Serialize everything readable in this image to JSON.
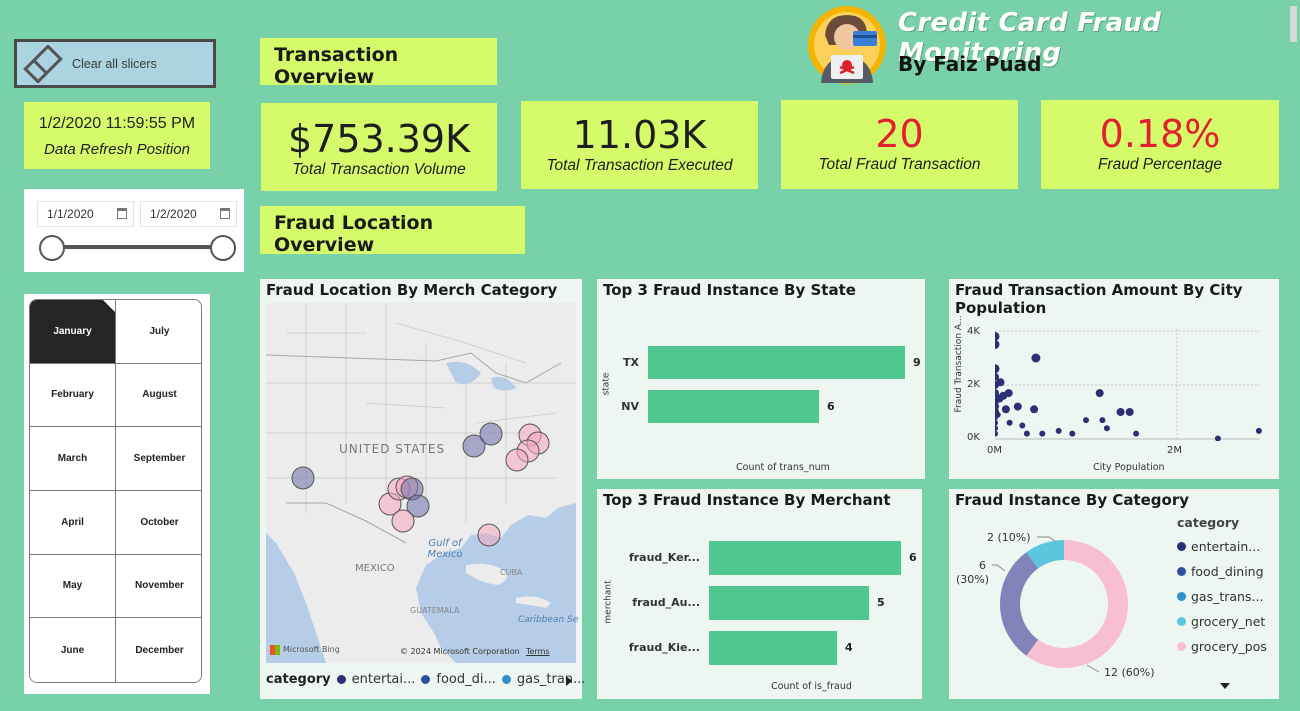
{
  "header": {
    "title": "Credit Card Fraud Monitoring",
    "subtitle": "By Faiz Puad"
  },
  "slicers": {
    "clear_label": "Clear all slicers",
    "refresh_datetime": "1/2/2020 11:59:55 PM",
    "refresh_label": "Data Refresh Position",
    "date_start": "1/1/2020",
    "date_end": "1/2/2020",
    "months": [
      "January",
      "July",
      "February",
      "August",
      "March",
      "September",
      "April",
      "October",
      "May",
      "November",
      "June",
      "December"
    ],
    "selected_month": "January"
  },
  "sections": {
    "overview": "Transaction Overview",
    "location": "Fraud Location Overview"
  },
  "kpis": {
    "volume": {
      "value": "$753.39K",
      "label": "Total Transaction Volume"
    },
    "executed": {
      "value": "11.03K",
      "label": "Total Transaction Executed"
    },
    "fraud_count": {
      "value": "20",
      "label": "Total Fraud Transaction"
    },
    "fraud_pct": {
      "value": "0.18%",
      "label": "Fraud Percentage"
    }
  },
  "map": {
    "title": "Fraud Location By Merch Category",
    "labels": {
      "us": "UNITED STATES",
      "gulf": "Gulf of\nMexico",
      "mexico": "MEXICO",
      "cuba": "CUBA",
      "guatemala": "GUATEMALA",
      "caribbean": "Caribbean Se",
      "bing": "Microsoft Bing",
      "copyright": "© 2024 Microsoft Corporation",
      "terms": "Terms"
    },
    "legend_title": "category",
    "legend_items": [
      "entertai...",
      "food_di...",
      "gas_tran..."
    ]
  },
  "colors": {
    "background": "#78d1a9",
    "lime": "#d5fb6b",
    "bar": "#4fc88f",
    "red": "#e3202f",
    "entertainment": "#2b2f73",
    "food_dining": "#2d4f9b",
    "gas_transport": "#2e8fc9",
    "grocery_net": "#5bc6de",
    "grocery_pos": "#f7bfd0",
    "donut_entertainment": "#8184b8"
  },
  "charts": {
    "by_state": {
      "title": "Top 3 Fraud Instance By State",
      "ylabel": "state",
      "xlabel": "Count of trans_num"
    },
    "by_merchant": {
      "title": "Top 3 Fraud Instance By Merchant",
      "ylabel": "merchant",
      "xlabel": "Count of is_fraud"
    },
    "by_city": {
      "title": "Fraud Transaction Amount By City Population",
      "ylabel": "Fraud Transaction A...",
      "xlabel": "City Population",
      "yticks": [
        "4K",
        "2K",
        "0K"
      ],
      "xticks": [
        "0M",
        "2M"
      ]
    },
    "by_category": {
      "title": "Fraud Instance By Category",
      "legend_title": "category",
      "legend_items": [
        "entertain...",
        "food_dining",
        "gas_trans...",
        "grocery_net",
        "grocery_pos"
      ],
      "label_2": "2 (10%)",
      "label_6": "6",
      "label_6b": "(30%)",
      "label_12": "12 (60%)"
    }
  },
  "chart_data": [
    {
      "type": "bar",
      "title": "Top 3 Fraud Instance By State",
      "categories": [
        "TX",
        "NV"
      ],
      "values": [
        9,
        6
      ],
      "xlabel": "Count of trans_num",
      "ylabel": "state"
    },
    {
      "type": "bar",
      "title": "Top 3 Fraud Instance By Merchant",
      "categories": [
        "fraud_Ker...",
        "fraud_Au...",
        "fraud_Kie..."
      ],
      "values": [
        6,
        5,
        4
      ],
      "xlabel": "Count of is_fraud",
      "ylabel": "merchant"
    },
    {
      "type": "scatter",
      "title": "Fraud Transaction Amount By City Population",
      "xlabel": "City Population",
      "ylabel": "Fraud Transaction A...",
      "xlim": [
        0,
        3000000
      ],
      "ylim": [
        0,
        4000
      ],
      "points": [
        {
          "x": 0,
          "y": 3800
        },
        {
          "x": 0,
          "y": 3500
        },
        {
          "x": 450000,
          "y": 3000
        },
        {
          "x": 0,
          "y": 2600
        },
        {
          "x": 0,
          "y": 2300
        },
        {
          "x": 0,
          "y": 2000
        },
        {
          "x": 0,
          "y": 1700
        },
        {
          "x": 0,
          "y": 1400
        },
        {
          "x": 0,
          "y": 1200
        },
        {
          "x": 0,
          "y": 1000
        },
        {
          "x": 0,
          "y": 800
        },
        {
          "x": 0,
          "y": 600
        },
        {
          "x": 0,
          "y": 400
        },
        {
          "x": 0,
          "y": 200
        },
        {
          "x": 30000,
          "y": 900
        },
        {
          "x": 50000,
          "y": 1500
        },
        {
          "x": 60000,
          "y": 2100
        },
        {
          "x": 90000,
          "y": 1600
        },
        {
          "x": 120000,
          "y": 1100
        },
        {
          "x": 150000,
          "y": 1700
        },
        {
          "x": 160000,
          "y": 600
        },
        {
          "x": 250000,
          "y": 1200
        },
        {
          "x": 300000,
          "y": 500
        },
        {
          "x": 350000,
          "y": 200
        },
        {
          "x": 430000,
          "y": 1100
        },
        {
          "x": 520000,
          "y": 200
        },
        {
          "x": 700000,
          "y": 300
        },
        {
          "x": 850000,
          "y": 200
        },
        {
          "x": 1000000,
          "y": 700
        },
        {
          "x": 1150000,
          "y": 1700
        },
        {
          "x": 1180000,
          "y": 700
        },
        {
          "x": 1230000,
          "y": 400
        },
        {
          "x": 1380000,
          "y": 1000
        },
        {
          "x": 1480000,
          "y": 1000
        },
        {
          "x": 1550000,
          "y": 200
        },
        {
          "x": 2450000,
          "y": 20
        },
        {
          "x": 2900000,
          "y": 300
        }
      ]
    },
    {
      "type": "pie",
      "title": "Fraud Instance By Category",
      "categories": [
        "entertainment",
        "food_dining",
        "gas_transport",
        "grocery_net",
        "grocery_pos"
      ],
      "values": [
        6,
        0,
        0,
        2,
        12
      ]
    }
  ]
}
